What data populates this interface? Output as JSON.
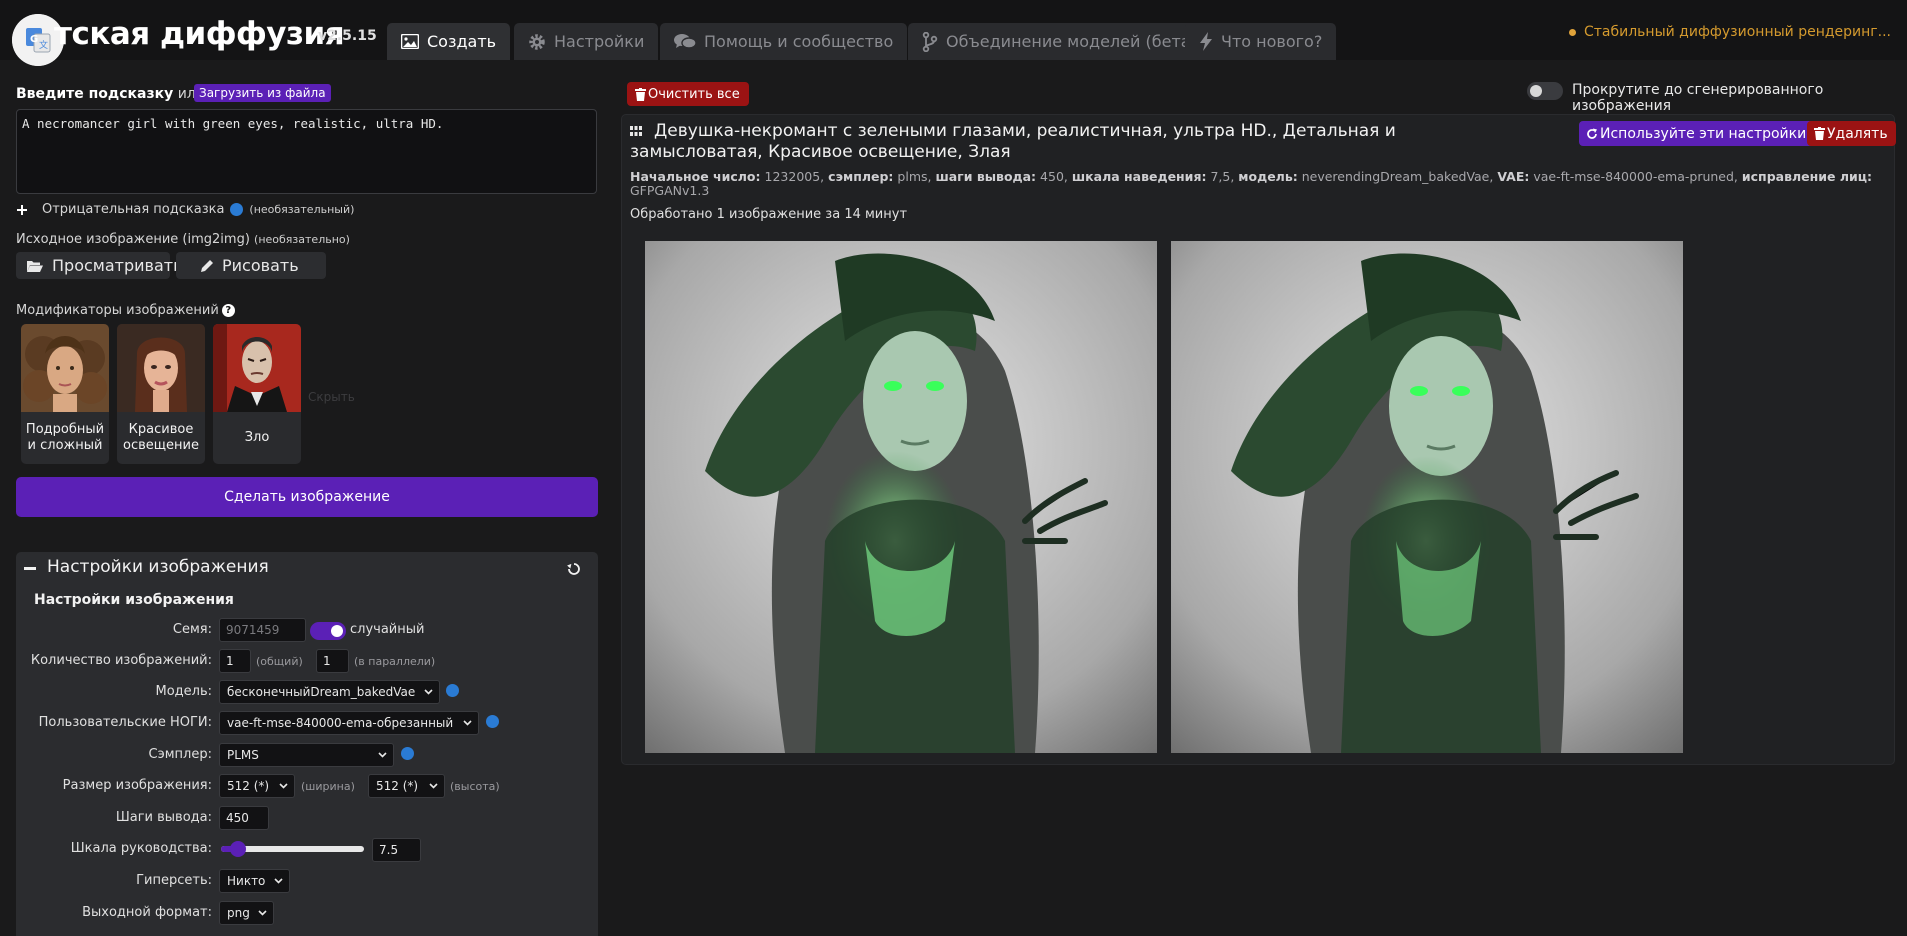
{
  "header": {
    "title": "тская диффузия",
    "version": "v2.5.15",
    "tabs": [
      {
        "label": "Создать",
        "icon": "image-icon",
        "active": true
      },
      {
        "label": "Настройки",
        "icon": "gear-icon",
        "active": false
      },
      {
        "label": "Помощь и сообщество",
        "icon": "comments-icon",
        "active": false
      },
      {
        "label": "Объединение моделей (бета)",
        "icon": "code-branch-icon",
        "active": false
      },
      {
        "label": "Что нового?",
        "icon": "bolt-icon",
        "active": false
      }
    ],
    "status": "Стабильный диффузионный рендеринг..."
  },
  "prompt": {
    "label": "Введите подсказку",
    "or": "или",
    "load_button": "Загрузить из файла",
    "value": "A necromancer girl with green eyes, realistic, ultra HD."
  },
  "negative": {
    "label": "Отрицательная подсказка",
    "optional": "(необязательный)"
  },
  "init_image": {
    "label": "Исходное изображение (img2img)",
    "optional": "(необязательно)",
    "browse": "Просматривать",
    "draw": "Рисовать"
  },
  "modifiers": {
    "label": "Модификаторы изображений",
    "items": [
      {
        "label": "Подробный и сложный"
      },
      {
        "label": "Красивое освещение"
      },
      {
        "label": "Зло"
      }
    ],
    "more": "Скрыть"
  },
  "make_button": "Сделать изображение",
  "settings": {
    "title": "Настройки изображения",
    "subtitle": "Настройки изображения",
    "seed": {
      "label": "Семя:",
      "value": "9071459",
      "random_label": "случайный",
      "random": true
    },
    "num_images": {
      "label": "Количество изображений:",
      "total": "1",
      "total_hint": "(общий)",
      "parallel": "1",
      "parallel_hint": "(в параллели)"
    },
    "model": {
      "label": "Модель:",
      "value": "бесконечныйDream_bakedVae"
    },
    "vae": {
      "label": "Пользовательские НОГИ:",
      "value": "vae-ft-mse-840000-ema-обрезанный"
    },
    "sampler": {
      "label": "Сэмплер:",
      "value": "PLMS"
    },
    "size": {
      "label": "Размер изображения:",
      "width": "512 (*)",
      "width_hint": "(ширина)",
      "height": "512 (*)",
      "height_hint": "(высота)"
    },
    "steps": {
      "label": "Шаги вывода:",
      "value": "450"
    },
    "guidance": {
      "label": "Шкала руководства:",
      "value": "7.5",
      "slider_fraction": 0.12
    },
    "hypernetwork": {
      "label": "Гиперсеть:",
      "value": "Никто"
    },
    "format": {
      "label": "Выходной формат:",
      "value": "png"
    }
  },
  "right": {
    "clear_button": "Очистить все",
    "scroll_label": "Прокрутите до сгенерированного изображения",
    "result": {
      "prompt": "Девушка-некромант с зелеными глазами, реалистичная, ультра HD., Детальная и замысловатая, Красивое освещение, Злая",
      "use_settings_button": "Используйте эти настройки",
      "delete_button": "Удалять",
      "params": {
        "seed_label": "Начальное число:",
        "seed": "1232005,",
        "sampler_label": "сэмплер:",
        "sampler": "plms,",
        "steps_label": "шаги вывода:",
        "steps": "450,",
        "guidance_label": "шкала наведения:",
        "guidance": "7,5,",
        "model_label": "модель:",
        "model": "neverendingDream_bakedVae,",
        "vae_label": "VAE:",
        "vae": "vae-ft-mse-840000-ema-pruned,",
        "face_label": "исправление лиц:",
        "face": "GFPGANv1.3"
      },
      "processed": "Обработано 1 изображение за 14 минут"
    }
  },
  "colors": {
    "accent": "#5b20b6",
    "danger": "#9b1313",
    "status": "#d49a2e",
    "background": "#1a1a1b"
  }
}
